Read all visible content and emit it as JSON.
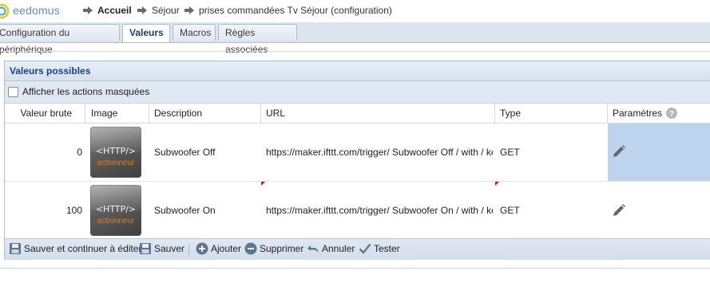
{
  "header": {
    "brand": "eedomus",
    "breadcrumbs": [
      "Accueil",
      "Séjour",
      "prises commandées Tv Séjour (configuration)"
    ]
  },
  "tabs": [
    "Configuration du périphérique",
    "Valeurs",
    "Macros",
    "Règles associées"
  ],
  "active_tab": "Valeurs",
  "panel": {
    "title": "Valeurs possibles",
    "show_masked_label": "Afficher les actions masquées",
    "show_masked_checked": false
  },
  "grid": {
    "headers": {
      "raw_value": "Valeur brute",
      "image": "Image",
      "description": "Description",
      "url": "URL",
      "type": "Type",
      "params": "Paramètres"
    },
    "rows": [
      {
        "raw_value": "0",
        "image_text": "<HTTP/>",
        "image_sub": "actionneur",
        "description": "Subwoofer Off",
        "url": "https://maker.ifttt.com/trigger/ Subwoofer Off / with / key...",
        "type": "GET",
        "highlighted": true
      },
      {
        "raw_value": "100",
        "image_text": "<HTTP/>",
        "image_sub": "actionneur",
        "description": "Subwoofer On",
        "url": "https://maker.ifttt.com/trigger/ Subwoofer On / with / key...",
        "type": "GET",
        "highlighted": false
      }
    ]
  },
  "toolbar": {
    "save_continue": "Sauver et continuer à éditer",
    "save": "Sauver",
    "add": "Ajouter",
    "delete": "Supprimer",
    "cancel": "Annuler",
    "test": "Tester"
  },
  "colors": {
    "accent": "#15428b",
    "highlight": "#bed3ee",
    "marker_red": "#c0191b",
    "http_orange": "#e07e1a"
  }
}
